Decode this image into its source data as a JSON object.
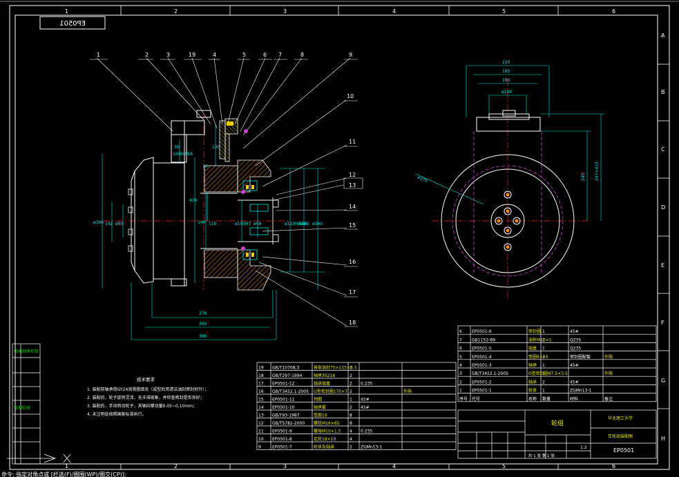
{
  "drawing": {
    "code_topleft": "EP0501",
    "grid_cols": [
      "1",
      "2",
      "3",
      "4",
      "5",
      "6"
    ],
    "grid_rows": [
      "A",
      "B",
      "C",
      "D",
      "E",
      "F",
      "G",
      "H"
    ],
    "balloons": [
      "1",
      "2",
      "3",
      "19",
      "4",
      "5",
      "6",
      "7",
      "8",
      "9",
      "10",
      "11",
      "12",
      "13",
      "14",
      "15",
      "16",
      "17",
      "18"
    ],
    "dims_front": {
      "d30": "30",
      "d100h7": "100H7/k6",
      "d135": "135",
      "d10": "10",
      "d434": "434",
      "d140": "140",
      "d110": "110",
      "d380": "ø380",
      "d142": "142",
      "d60": "ø60",
      "d40": "ø40",
      "d100": "ø100H7",
      "d48": "ø48",
      "d110h7": "ø110H7/k6",
      "d260": "ø260",
      "d340": "ø340",
      "d276": "276",
      "d260b": "260",
      "d380b": "380"
    },
    "dims_side": {
      "d220": "220",
      "d185": "185",
      "d180": "180",
      "d100": "ø100",
      "d245": "245",
      "d297": "297+415",
      "d370": "ø370"
    },
    "tech_req": {
      "title": "技术要求",
      "lines": [
        "1. 装配前轴承用GY24润滑脂填充（成型后用清洁油封密封好外）；",
        "2. 装配后，轮子旋转灵活，无卡滞现象，并检查密封是否良好；",
        "3. 装配后，手动转动轮子，其轴向窜动量0.05~0.10mm；",
        "4. 未注明处按照国家标准执行。"
      ]
    },
    "left_strip": [
      "电机轴承检修",
      "",
      "",
      "",
      "",
      "",
      "",
      "日期检修",
      "",
      ""
    ],
    "bom_left": [
      [
        "19",
        "GB/T10708.3",
        "骨架油封75×115×6.5",
        "1",
        "",
        ""
      ],
      [
        "18",
        "GB/T297-1994",
        "轴承30218",
        "2",
        "",
        ""
      ],
      [
        "17",
        "EP0501-12",
        "轴承端盖",
        "2",
        "0.235",
        "",
        ""
      ],
      [
        "16",
        "GB/T3452.1-2005",
        "O型密封圈170×7",
        "2",
        "",
        "外购"
      ],
      [
        "15",
        "EP0501-11",
        "挡圈",
        "1",
        "45#",
        ""
      ],
      [
        "14",
        "EP0501-10",
        "轴承套",
        "2",
        "45#",
        ""
      ],
      [
        "13",
        "GB/T93-1987",
        "垫圈16",
        "8",
        "",
        ""
      ],
      [
        "12",
        "GB/T5782-2000",
        "螺栓M16×65",
        "8",
        "",
        ""
      ],
      [
        "11",
        "EP0501-9",
        "螺母M10×1.5",
        "4",
        "0.235",
        ""
      ],
      [
        "10",
        "EP0501-8",
        "走轮18×10",
        "4",
        "",
        ""
      ],
      [
        "9",
        "EP0501-7",
        "轮体及轴承",
        "2",
        "ZGMn13-1",
        ""
      ]
    ],
    "bom_right": [
      [
        "6",
        "EP0501-6",
        "密封圈",
        "1",
        "45#",
        ""
      ],
      [
        "7",
        "GB1152-89",
        "油杯M10×1",
        "1",
        "Q235",
        ""
      ],
      [
        "6",
        "EP0501-5",
        "端盖",
        "1",
        "Q235",
        ""
      ],
      [
        "5",
        "EP0501-4",
        "垫圈6×24",
        "1",
        "密封圈配套",
        "外购"
      ],
      [
        "4",
        "EP0501-3",
        "轴承",
        "1",
        "45#",
        ""
      ],
      [
        "3",
        "GB/T3452.1-2005",
        "O型密封圈97.5×3.5",
        "1",
        "",
        "外购"
      ],
      [
        "2",
        "EP0501-2",
        "轴承",
        "2",
        "45#",
        ""
      ],
      [
        "1",
        "EP0501-1",
        "轮体",
        "1",
        "ZGMn13-1",
        ""
      ]
    ],
    "bom_header": [
      "序号",
      "代号",
      "名称",
      "数量",
      "材料",
      "备注"
    ],
    "title_block": {
      "part_name": "轮组",
      "company": "华北理工大学",
      "drawing_title": "车轮组装配图",
      "drawing_no": "EP0501",
      "scale": "1:2",
      "sheet": "共 1 张  第 1 张"
    },
    "status_bar": "命令: 指定对角点或 [栏选(F)/圈围(WP)/圈交(CP)]:"
  }
}
